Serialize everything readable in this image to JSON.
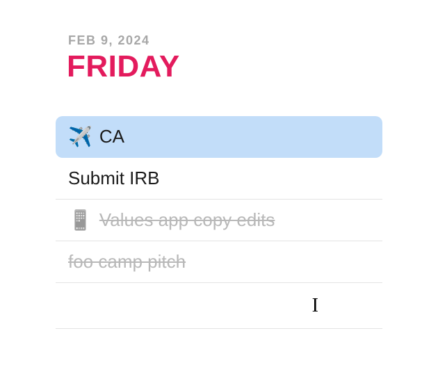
{
  "header": {
    "date_label": "FEB 9, 2024",
    "day_name": "FRIDAY"
  },
  "tasks": [
    {
      "icon": "✈️",
      "text": "CA",
      "completed": false,
      "selected": true
    },
    {
      "icon": "",
      "text": "Submit IRB",
      "completed": false,
      "selected": false
    },
    {
      "icon": "📱",
      "text": "Values app copy edits",
      "completed": true,
      "selected": false
    },
    {
      "icon": "",
      "text": "foo camp pitch",
      "completed": true,
      "selected": false
    }
  ],
  "empty_row": {
    "has_cursor": true
  }
}
